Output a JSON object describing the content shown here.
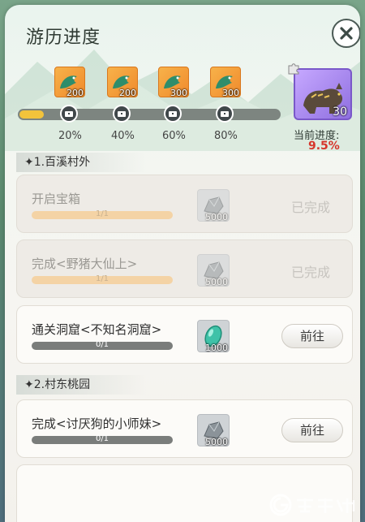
{
  "title": "游历进度",
  "progress": {
    "fraction": 0.095,
    "milestones": [
      {
        "label": "20%",
        "reward_count": "200"
      },
      {
        "label": "40%",
        "reward_count": "200"
      },
      {
        "label": "60%",
        "reward_count": "300"
      },
      {
        "label": "80%",
        "reward_count": "300"
      }
    ],
    "final_reward_level": "30",
    "current_label": "当前进度:",
    "current_value": "9.5%"
  },
  "sections": [
    {
      "header": "1.百溪村外",
      "tasks": [
        {
          "name": "开启宝箱",
          "progress": "1/1",
          "reward": "5000",
          "status": "已完成"
        },
        {
          "name": "完成<野猪大仙上>",
          "progress": "1/1",
          "reward": "5000",
          "status": "已完成"
        },
        {
          "name": "通关洞窟<不知名洞窟>",
          "progress": "0/1",
          "reward": "1000",
          "action": "前往"
        }
      ]
    },
    {
      "header": "2.村东桃园",
      "tasks": [
        {
          "name": "完成<讨厌狗的小师妹>",
          "progress": "0/1",
          "reward": "5000",
          "action": "前往"
        }
      ]
    }
  ],
  "colors": {
    "progress_fill": "#f2c33b",
    "current_value": "#d6352b",
    "pet_card": "#8f6fe0"
  }
}
